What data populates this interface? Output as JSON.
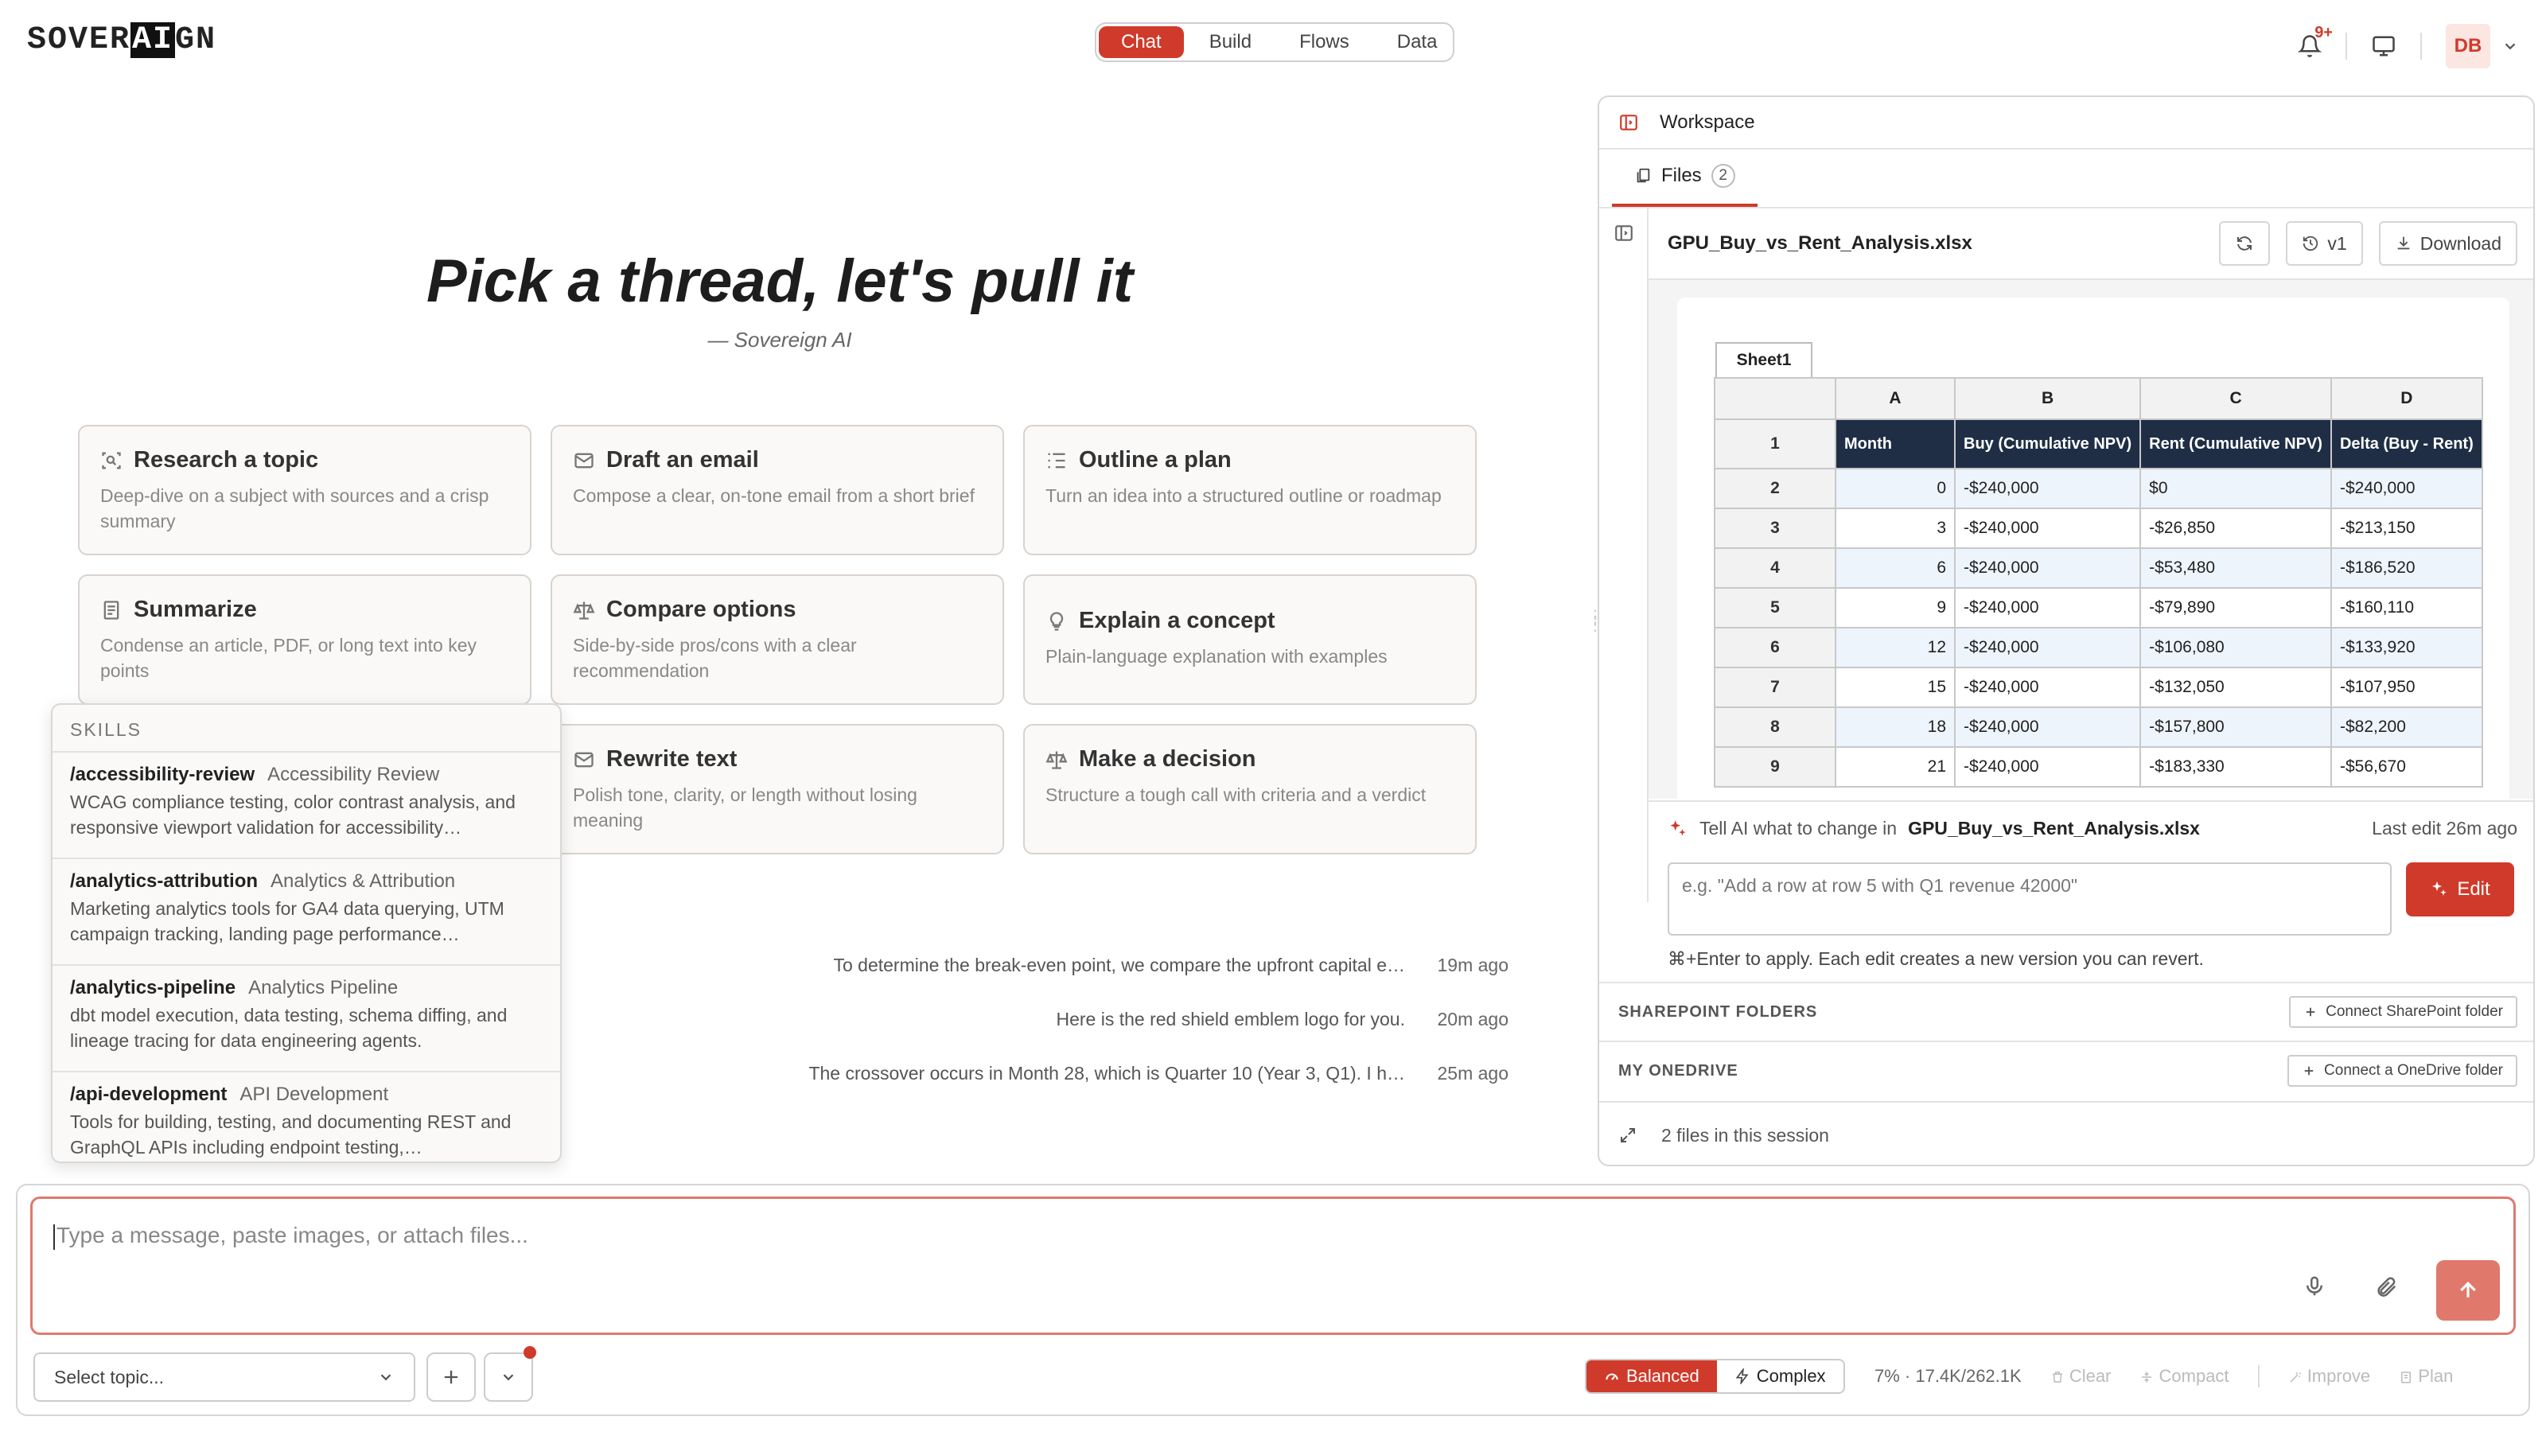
{
  "app": {
    "logo_pre": "SOVER",
    "logo_inv": "AI",
    "logo_post": "GN"
  },
  "nav": {
    "tabs": [
      {
        "label": "Chat"
      },
      {
        "label": "Build"
      },
      {
        "label": "Flows"
      },
      {
        "label": "Data"
      }
    ]
  },
  "header": {
    "notif_badge": "9+",
    "avatar": "DB"
  },
  "hero": {
    "title": "Pick a thread, let's pull it",
    "subtitle": "— Sovereign AI"
  },
  "cards": [
    {
      "title": "Research a topic",
      "desc": "Deep-dive on a subject with sources and a crisp summary",
      "icon": "scan-search-icon"
    },
    {
      "title": "Draft an email",
      "desc": "Compose a clear, on-tone email from a short brief",
      "icon": "mail-icon"
    },
    {
      "title": "Outline a plan",
      "desc": "Turn an idea into a structured outline or roadmap",
      "icon": "list-outline-icon"
    },
    {
      "title": "Summarize",
      "desc": "Condense an article, PDF, or long text into key points",
      "icon": "document-icon"
    },
    {
      "title": "Compare options",
      "desc": "Side-by-side pros/cons with a clear recommendation",
      "icon": "scale-icon"
    },
    {
      "title": "Explain a concept",
      "desc": "Plain-language explanation with examples",
      "icon": "lightbulb-icon"
    },
    {
      "title": "Rewrite text",
      "desc": "Polish tone, clarity, or length without losing meaning",
      "icon": "mail-icon"
    },
    {
      "title": "Make a decision",
      "desc": "Structure a tough call with criteria and a verdict",
      "icon": "scale-icon"
    }
  ],
  "skills": {
    "header": "SKILLS",
    "items": [
      {
        "cmd": "/accessibility-review",
        "name": "Accessibility Review",
        "desc": "WCAG compliance testing, color contrast analysis, and responsive viewport validation for accessibility…"
      },
      {
        "cmd": "/analytics-attribution",
        "name": "Analytics & Attribution",
        "desc": "Marketing analytics tools for GA4 data querying, UTM campaign tracking, landing page performance…"
      },
      {
        "cmd": "/analytics-pipeline",
        "name": "Analytics Pipeline",
        "desc": "dbt model execution, data testing, schema diffing, and lineage tracing for data engineering agents."
      },
      {
        "cmd": "/api-development",
        "name": "API Development",
        "desc": "Tools for building, testing, and documenting REST and GraphQL APIs including endpoint testing,…"
      }
    ]
  },
  "recent": [
    {
      "text": "To determine the break-even point, we compare the upfront capital e…",
      "time": "19m ago"
    },
    {
      "text": "Here is the red shield emblem logo for you.",
      "time": "20m ago"
    },
    {
      "text": "The crossover occurs in Month 28, which is Quarter 10 (Year 3, Q1). I h…",
      "time": "25m ago"
    }
  ],
  "workspace": {
    "title": "Workspace",
    "tab_label": "Files",
    "tab_count": "2",
    "file_name": "GPU_Buy_vs_Rent_Analysis.xlsx",
    "version": "v1",
    "download": "Download",
    "sheet_tab": "Sheet1",
    "columns": [
      "A",
      "B",
      "C",
      "D"
    ],
    "header_row": {
      "num": "1",
      "cells": [
        "Month",
        "Buy (Cumulative NPV)",
        "Rent (Cumulative NPV)",
        "Delta (Buy - Rent)"
      ]
    },
    "rows": [
      {
        "num": "2",
        "a": "0",
        "b": "-$240,000",
        "c": "$0",
        "d": "-$240,000"
      },
      {
        "num": "3",
        "a": "3",
        "b": "-$240,000",
        "c": "-$26,850",
        "d": "-$213,150"
      },
      {
        "num": "4",
        "a": "6",
        "b": "-$240,000",
        "c": "-$53,480",
        "d": "-$186,520"
      },
      {
        "num": "5",
        "a": "9",
        "b": "-$240,000",
        "c": "-$79,890",
        "d": "-$160,110"
      },
      {
        "num": "6",
        "a": "12",
        "b": "-$240,000",
        "c": "-$106,080",
        "d": "-$133,920"
      },
      {
        "num": "7",
        "a": "15",
        "b": "-$240,000",
        "c": "-$132,050",
        "d": "-$107,950"
      },
      {
        "num": "8",
        "a": "18",
        "b": "-$240,000",
        "c": "-$157,800",
        "d": "-$82,200"
      },
      {
        "num": "9",
        "a": "21",
        "b": "-$240,000",
        "c": "-$183,330",
        "d": "-$56,670"
      }
    ],
    "ai_prompt": "Tell AI what to change in",
    "last_edit": "Last edit 26m ago",
    "ai_placeholder": "e.g. \"Add a row at row 5 with Q1 revenue 42000\"",
    "edit_label": "Edit",
    "ai_hint": "⌘+Enter to apply. Each edit creates a new version you can revert.",
    "sharepoint_label": "SHAREPOINT FOLDERS",
    "sharepoint_btn": "Connect SharePoint folder",
    "onedrive_label": "MY ONEDRIVE",
    "onedrive_btn": "Connect a OneDrive folder",
    "footer": "2 files in this session"
  },
  "composer": {
    "placeholder": "Type a message, paste images, or attach files...",
    "topic": "Select topic...",
    "mode_balanced": "Balanced",
    "mode_complex": "Complex",
    "usage": "7% · 17.4K/262.1K",
    "clear": "Clear",
    "compact": "Compact",
    "improve": "Improve",
    "plan": "Plan"
  },
  "colors": {
    "accent": "#d03a2b",
    "header_cell": "#1f2e45"
  }
}
